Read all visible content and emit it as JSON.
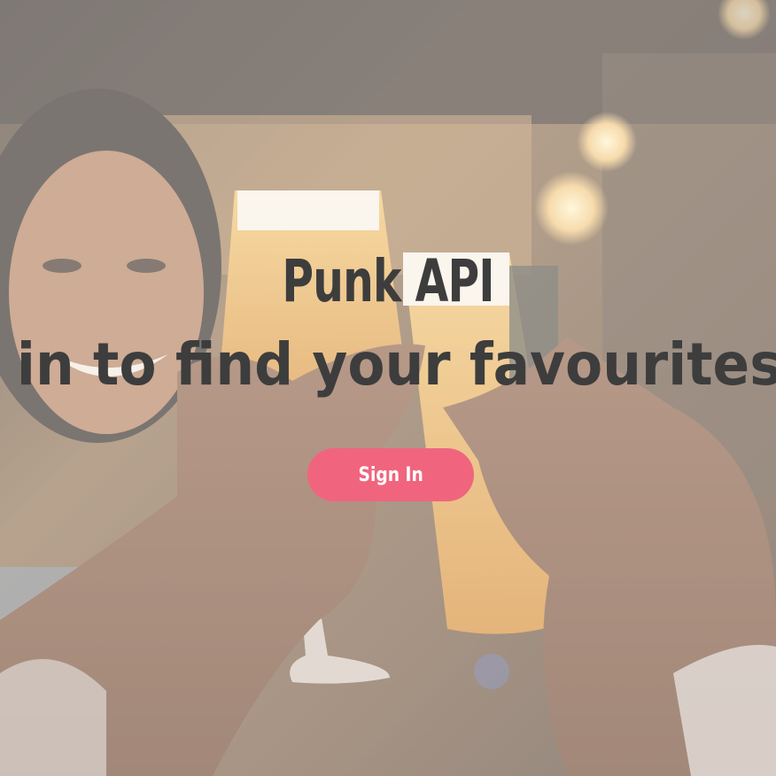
{
  "hero": {
    "image_description_icon": "beer-cheers-photo",
    "title": "Punk API",
    "subtitle": "Sign in to find your favourites beers",
    "signin_label": "Sign In"
  },
  "colors": {
    "button": "#f0657d",
    "text": "#3d3d3d",
    "overlay": "rgba(255,255,255,0.38)"
  }
}
